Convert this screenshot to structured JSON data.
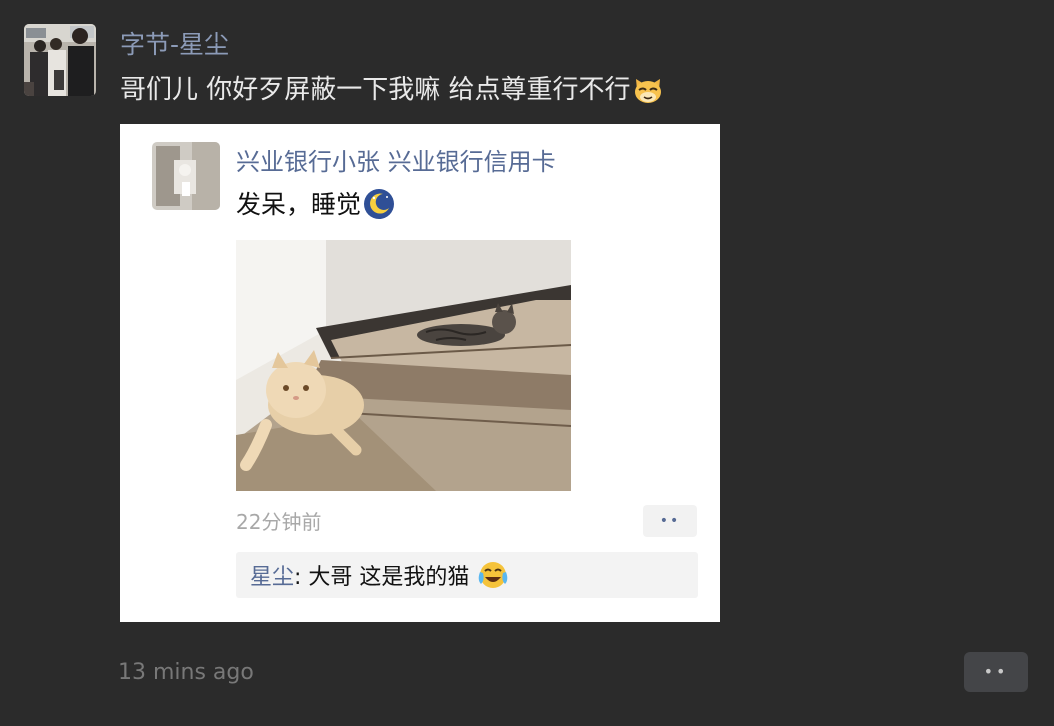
{
  "post": {
    "author": "字节-星尘",
    "text": "哥们儿 你好歹屏蔽一下我嘛 给点尊重行不行",
    "text_emoji": "cat-face-emoji",
    "time": "13 mins ago",
    "more_icon": "ellipsis-icon",
    "more_label": "••"
  },
  "shared_screenshot": {
    "author": "兴业银行小张 兴业银行信用卡",
    "text": "发呆，睡觉",
    "text_emoji": "moon-emoji",
    "photo": "two-cats-on-stairs",
    "time": "22分钟前",
    "more_label": "••",
    "comment": {
      "name": "星尘",
      "separator": ": ",
      "text": "大哥 这是我的猫",
      "emoji": "face-with-tears-of-joy-emoji"
    }
  },
  "colors": {
    "background": "#2b2b2b",
    "author_name": "#8c9bb8",
    "link_blue": "#576b95",
    "secondary_text": "#787878"
  }
}
